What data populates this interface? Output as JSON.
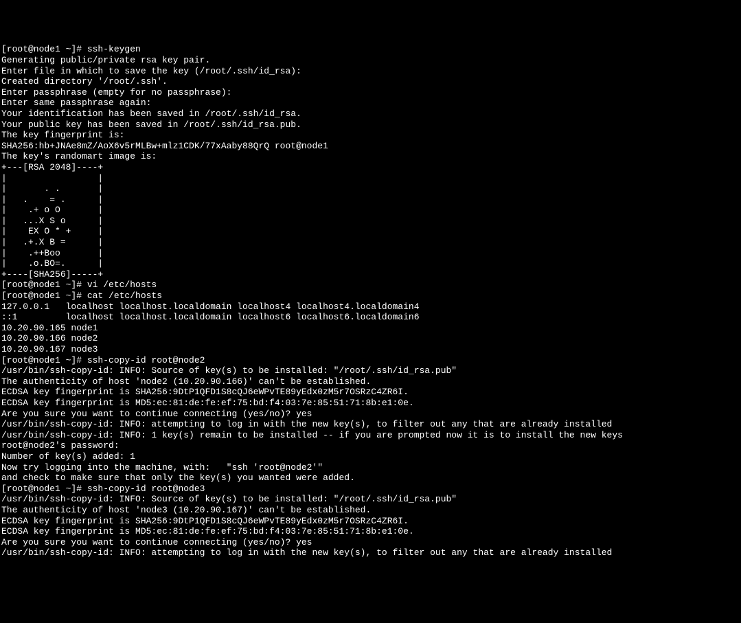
{
  "lines": [
    "[root@node1 ~]# ssh-keygen",
    "Generating public/private rsa key pair.",
    "Enter file in which to save the key (/root/.ssh/id_rsa):",
    "Created directory '/root/.ssh'.",
    "Enter passphrase (empty for no passphrase):",
    "Enter same passphrase again:",
    "Your identification has been saved in /root/.ssh/id_rsa.",
    "Your public key has been saved in /root/.ssh/id_rsa.pub.",
    "The key fingerprint is:",
    "SHA256:hb+JNAe8mZ/AoX6v5rMLBw+mlz1CDK/77xAaby88QrQ root@node1",
    "The key's randomart image is:",
    "+---[RSA 2048]----+",
    "|                 |",
    "|       . .       |",
    "|   .    = .      |",
    "|    .+ o O       |",
    "|   ...X S o      |",
    "|    EX O * +     |",
    "|   .+.X B =      |",
    "|    .++Boo       |",
    "|    .o.BO=.      |",
    "+----[SHA256]-----+",
    "[root@node1 ~]# vi /etc/hosts",
    "[root@node1 ~]# cat /etc/hosts",
    "127.0.0.1   localhost localhost.localdomain localhost4 localhost4.localdomain4",
    "::1         localhost localhost.localdomain localhost6 localhost6.localdomain6",
    "10.20.90.165 node1",
    "10.20.90.166 node2",
    "10.20.90.167 node3",
    "[root@node1 ~]# ssh-copy-id root@node2",
    "/usr/bin/ssh-copy-id: INFO: Source of key(s) to be installed: \"/root/.ssh/id_rsa.pub\"",
    "The authenticity of host 'node2 (10.20.90.166)' can't be established.",
    "ECDSA key fingerprint is SHA256:9DtP1QFD1S8cQJ6eWPvTE89yEdx0zM5r7OSRzC4ZR6I.",
    "ECDSA key fingerprint is MD5:ec:81:de:fe:ef:75:bd:f4:03:7e:85:51:71:8b:e1:0e.",
    "Are you sure you want to continue connecting (yes/no)? yes",
    "/usr/bin/ssh-copy-id: INFO: attempting to log in with the new key(s), to filter out any that are already installed",
    "/usr/bin/ssh-copy-id: INFO: 1 key(s) remain to be installed -- if you are prompted now it is to install the new keys",
    "root@node2's password:",
    "",
    "Number of key(s) added: 1",
    "",
    "Now try logging into the machine, with:   \"ssh 'root@node2'\"",
    "and check to make sure that only the key(s) you wanted were added.",
    "",
    "[root@node1 ~]# ssh-copy-id root@node3",
    "/usr/bin/ssh-copy-id: INFO: Source of key(s) to be installed: \"/root/.ssh/id_rsa.pub\"",
    "The authenticity of host 'node3 (10.20.90.167)' can't be established.",
    "ECDSA key fingerprint is SHA256:9DtP1QFD1S8cQJ6eWPvTE89yEdx0zM5r7OSRzC4ZR6I.",
    "ECDSA key fingerprint is MD5:ec:81:de:fe:ef:75:bd:f4:03:7e:85:51:71:8b:e1:0e.",
    "Are you sure you want to continue connecting (yes/no)? yes",
    "/usr/bin/ssh-copy-id: INFO: attempting to log in with the new key(s), to filter out any that are already installed"
  ]
}
